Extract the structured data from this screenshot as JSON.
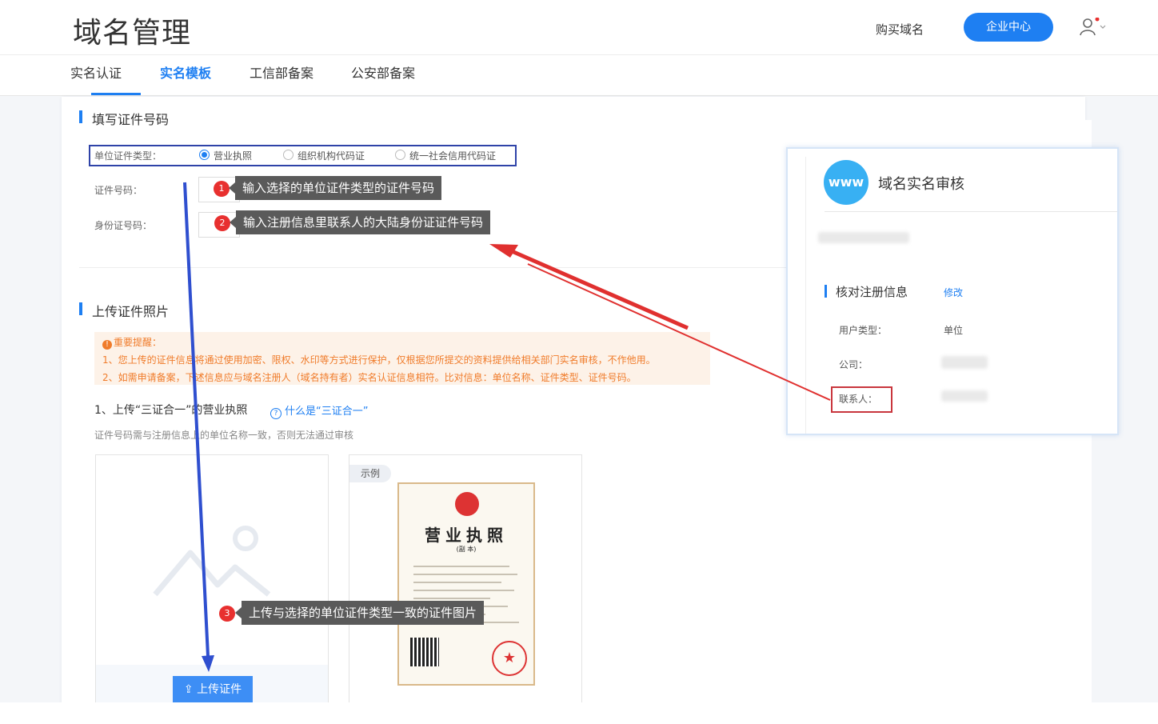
{
  "app_title": "域名管理",
  "header": {
    "buy_domain": "购买域名",
    "enterprise_center": "企业中心"
  },
  "tabs": [
    {
      "label": "实名认证"
    },
    {
      "label": "实名模板"
    },
    {
      "label": "工信部备案"
    },
    {
      "label": "公安部备案"
    }
  ],
  "form": {
    "section_title": "填写证件号码",
    "cert_type_label": "单位证件类型：",
    "cert_types": [
      "营业执照",
      "组织机构代码证",
      "统一社会信用代码证"
    ],
    "cert_no_label": "证件号码：",
    "id_no_label": "身份证号码："
  },
  "tips": {
    "tip1": {
      "num": "1",
      "text": "输入选择的单位证件类型的证件号码"
    },
    "tip2": {
      "num": "2",
      "text": "输入注册信息里联系人的大陆身份证证件号码"
    },
    "tip3": {
      "num": "3",
      "text": "上传与选择的单位证件类型一致的证件图片"
    }
  },
  "upload": {
    "section_title": "上传证件照片",
    "notice_title": "重要提醒：",
    "notice_line1": "1、您上传的证件信息将通过使用加密、限权、水印等方式进行保护，仅根据您所提交的资料提供给相关部门实名审核，不作他用。",
    "notice_line2": "2、如需申请备案，下述信息应与域名注册人（域名持有者）实名认证信息相符。比对信息：单位名称、证件类型、证件号码。",
    "step_title": "1、上传“三证合一”的营业执照",
    "help_link": "什么是“三证合一”",
    "note": "证件号码需与注册信息上的单位名称一致，否则无法通过审核",
    "upload_button": "上传证件",
    "sample_tag": "示例",
    "license_title": "营业执照",
    "license_sub": "(副 本)"
  },
  "popup": {
    "badge": "www",
    "title": "域名实名审核",
    "section": "核对注册信息",
    "edit": "修改",
    "user_type_label": "用户类型：",
    "user_type_value": "单位",
    "company_label": "公司：",
    "contact_label": "联系人："
  },
  "colors": {
    "accent": "#1e7ff2",
    "tip_bg": "#5a5a5a",
    "badge_red": "#e8302f",
    "notice_orange": "#f07c2b",
    "arrow_red": "#e0302f",
    "arrow_blue": "#2f4fcf"
  }
}
